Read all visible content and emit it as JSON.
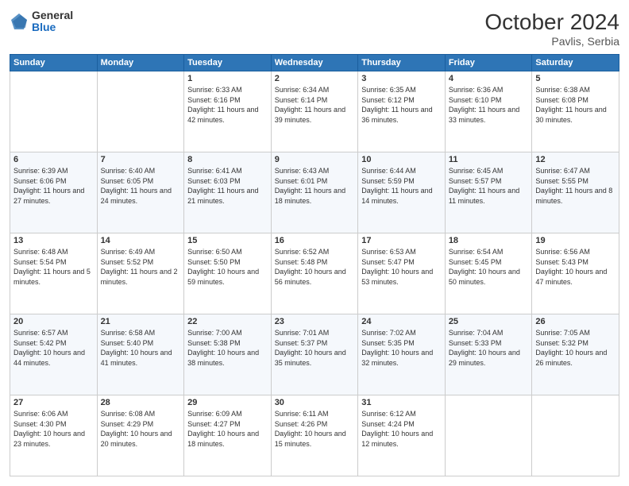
{
  "logo": {
    "general": "General",
    "blue": "Blue"
  },
  "header": {
    "month": "October 2024",
    "location": "Pavlis, Serbia"
  },
  "weekdays": [
    "Sunday",
    "Monday",
    "Tuesday",
    "Wednesday",
    "Thursday",
    "Friday",
    "Saturday"
  ],
  "weeks": [
    [
      {
        "day": "",
        "info": ""
      },
      {
        "day": "",
        "info": ""
      },
      {
        "day": "1",
        "info": "Sunrise: 6:33 AM\nSunset: 6:16 PM\nDaylight: 11 hours and 42 minutes."
      },
      {
        "day": "2",
        "info": "Sunrise: 6:34 AM\nSunset: 6:14 PM\nDaylight: 11 hours and 39 minutes."
      },
      {
        "day": "3",
        "info": "Sunrise: 6:35 AM\nSunset: 6:12 PM\nDaylight: 11 hours and 36 minutes."
      },
      {
        "day": "4",
        "info": "Sunrise: 6:36 AM\nSunset: 6:10 PM\nDaylight: 11 hours and 33 minutes."
      },
      {
        "day": "5",
        "info": "Sunrise: 6:38 AM\nSunset: 6:08 PM\nDaylight: 11 hours and 30 minutes."
      }
    ],
    [
      {
        "day": "6",
        "info": "Sunrise: 6:39 AM\nSunset: 6:06 PM\nDaylight: 11 hours and 27 minutes."
      },
      {
        "day": "7",
        "info": "Sunrise: 6:40 AM\nSunset: 6:05 PM\nDaylight: 11 hours and 24 minutes."
      },
      {
        "day": "8",
        "info": "Sunrise: 6:41 AM\nSunset: 6:03 PM\nDaylight: 11 hours and 21 minutes."
      },
      {
        "day": "9",
        "info": "Sunrise: 6:43 AM\nSunset: 6:01 PM\nDaylight: 11 hours and 18 minutes."
      },
      {
        "day": "10",
        "info": "Sunrise: 6:44 AM\nSunset: 5:59 PM\nDaylight: 11 hours and 14 minutes."
      },
      {
        "day": "11",
        "info": "Sunrise: 6:45 AM\nSunset: 5:57 PM\nDaylight: 11 hours and 11 minutes."
      },
      {
        "day": "12",
        "info": "Sunrise: 6:47 AM\nSunset: 5:55 PM\nDaylight: 11 hours and 8 minutes."
      }
    ],
    [
      {
        "day": "13",
        "info": "Sunrise: 6:48 AM\nSunset: 5:54 PM\nDaylight: 11 hours and 5 minutes."
      },
      {
        "day": "14",
        "info": "Sunrise: 6:49 AM\nSunset: 5:52 PM\nDaylight: 11 hours and 2 minutes."
      },
      {
        "day": "15",
        "info": "Sunrise: 6:50 AM\nSunset: 5:50 PM\nDaylight: 10 hours and 59 minutes."
      },
      {
        "day": "16",
        "info": "Sunrise: 6:52 AM\nSunset: 5:48 PM\nDaylight: 10 hours and 56 minutes."
      },
      {
        "day": "17",
        "info": "Sunrise: 6:53 AM\nSunset: 5:47 PM\nDaylight: 10 hours and 53 minutes."
      },
      {
        "day": "18",
        "info": "Sunrise: 6:54 AM\nSunset: 5:45 PM\nDaylight: 10 hours and 50 minutes."
      },
      {
        "day": "19",
        "info": "Sunrise: 6:56 AM\nSunset: 5:43 PM\nDaylight: 10 hours and 47 minutes."
      }
    ],
    [
      {
        "day": "20",
        "info": "Sunrise: 6:57 AM\nSunset: 5:42 PM\nDaylight: 10 hours and 44 minutes."
      },
      {
        "day": "21",
        "info": "Sunrise: 6:58 AM\nSunset: 5:40 PM\nDaylight: 10 hours and 41 minutes."
      },
      {
        "day": "22",
        "info": "Sunrise: 7:00 AM\nSunset: 5:38 PM\nDaylight: 10 hours and 38 minutes."
      },
      {
        "day": "23",
        "info": "Sunrise: 7:01 AM\nSunset: 5:37 PM\nDaylight: 10 hours and 35 minutes."
      },
      {
        "day": "24",
        "info": "Sunrise: 7:02 AM\nSunset: 5:35 PM\nDaylight: 10 hours and 32 minutes."
      },
      {
        "day": "25",
        "info": "Sunrise: 7:04 AM\nSunset: 5:33 PM\nDaylight: 10 hours and 29 minutes."
      },
      {
        "day": "26",
        "info": "Sunrise: 7:05 AM\nSunset: 5:32 PM\nDaylight: 10 hours and 26 minutes."
      }
    ],
    [
      {
        "day": "27",
        "info": "Sunrise: 6:06 AM\nSunset: 4:30 PM\nDaylight: 10 hours and 23 minutes."
      },
      {
        "day": "28",
        "info": "Sunrise: 6:08 AM\nSunset: 4:29 PM\nDaylight: 10 hours and 20 minutes."
      },
      {
        "day": "29",
        "info": "Sunrise: 6:09 AM\nSunset: 4:27 PM\nDaylight: 10 hours and 18 minutes."
      },
      {
        "day": "30",
        "info": "Sunrise: 6:11 AM\nSunset: 4:26 PM\nDaylight: 10 hours and 15 minutes."
      },
      {
        "day": "31",
        "info": "Sunrise: 6:12 AM\nSunset: 4:24 PM\nDaylight: 10 hours and 12 minutes."
      },
      {
        "day": "",
        "info": ""
      },
      {
        "day": "",
        "info": ""
      }
    ]
  ]
}
